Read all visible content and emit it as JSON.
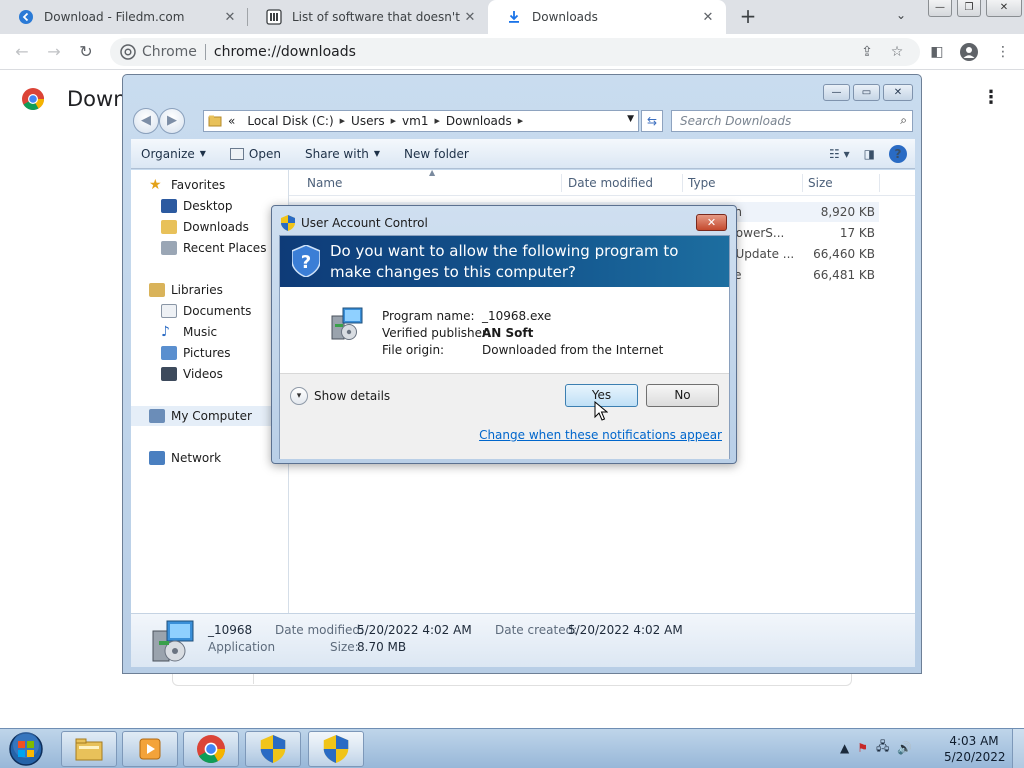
{
  "browser": {
    "tabs": [
      {
        "title": "Download - Filedm.com",
        "active": false
      },
      {
        "title": "List of software that doesn't supp",
        "active": false
      },
      {
        "title": "Downloads",
        "active": true
      }
    ],
    "site_label": "Chrome",
    "url": "chrome://downloads",
    "page_title": "Down"
  },
  "explorer": {
    "breadcrumb": [
      "Local Disk (C:)",
      "Users",
      "vm1",
      "Downloads"
    ],
    "breadcrumb_prefix": "«",
    "search_placeholder": "Search Downloads",
    "commands": {
      "organize": "Organize",
      "open": "Open",
      "share_with": "Share with",
      "new_folder": "New folder"
    },
    "nav": {
      "favorites": "Favorites",
      "desktop": "Desktop",
      "downloads": "Downloads",
      "recent_places": "Recent Places",
      "libraries": "Libraries",
      "documents": "Documents",
      "music": "Music",
      "pictures": "Pictures",
      "videos": "Videos",
      "my_computer": "My Computer",
      "network": "Network"
    },
    "columns": {
      "name": "Name",
      "date_modified": "Date modified",
      "type": "Type",
      "size": "Size"
    },
    "rows": [
      {
        "type": "on",
        "size": "8,920 KB"
      },
      {
        "type": "PowerS...",
        "size": "17 KB"
      },
      {
        "type": "t Update ...",
        "size": "66,460 KB"
      },
      {
        "type": "ve",
        "size": "66,481 KB"
      }
    ],
    "details": {
      "name": "_10968",
      "kind": "Application",
      "date_modified_label": "Date modified:",
      "date_modified": "5/20/2022 4:02 AM",
      "date_created_label": "Date created:",
      "date_created": "5/20/2022 4:02 AM",
      "size_label": "Size:",
      "size": "8.70 MB"
    }
  },
  "uac": {
    "title": "User Account Control",
    "question": "Do you want to allow the following program to make changes to this computer?",
    "program_name_label": "Program name:",
    "program_name": "_10968.exe",
    "publisher_label": "Verified publisher:",
    "publisher": "AN Soft",
    "origin_label": "File origin:",
    "origin": "Downloaded from the Internet",
    "show_details": "Show details",
    "yes": "Yes",
    "no": "No",
    "change_link": "Change when these notifications appear"
  },
  "taskbar": {
    "time": "4:03 AM",
    "date": "5/20/2022"
  }
}
